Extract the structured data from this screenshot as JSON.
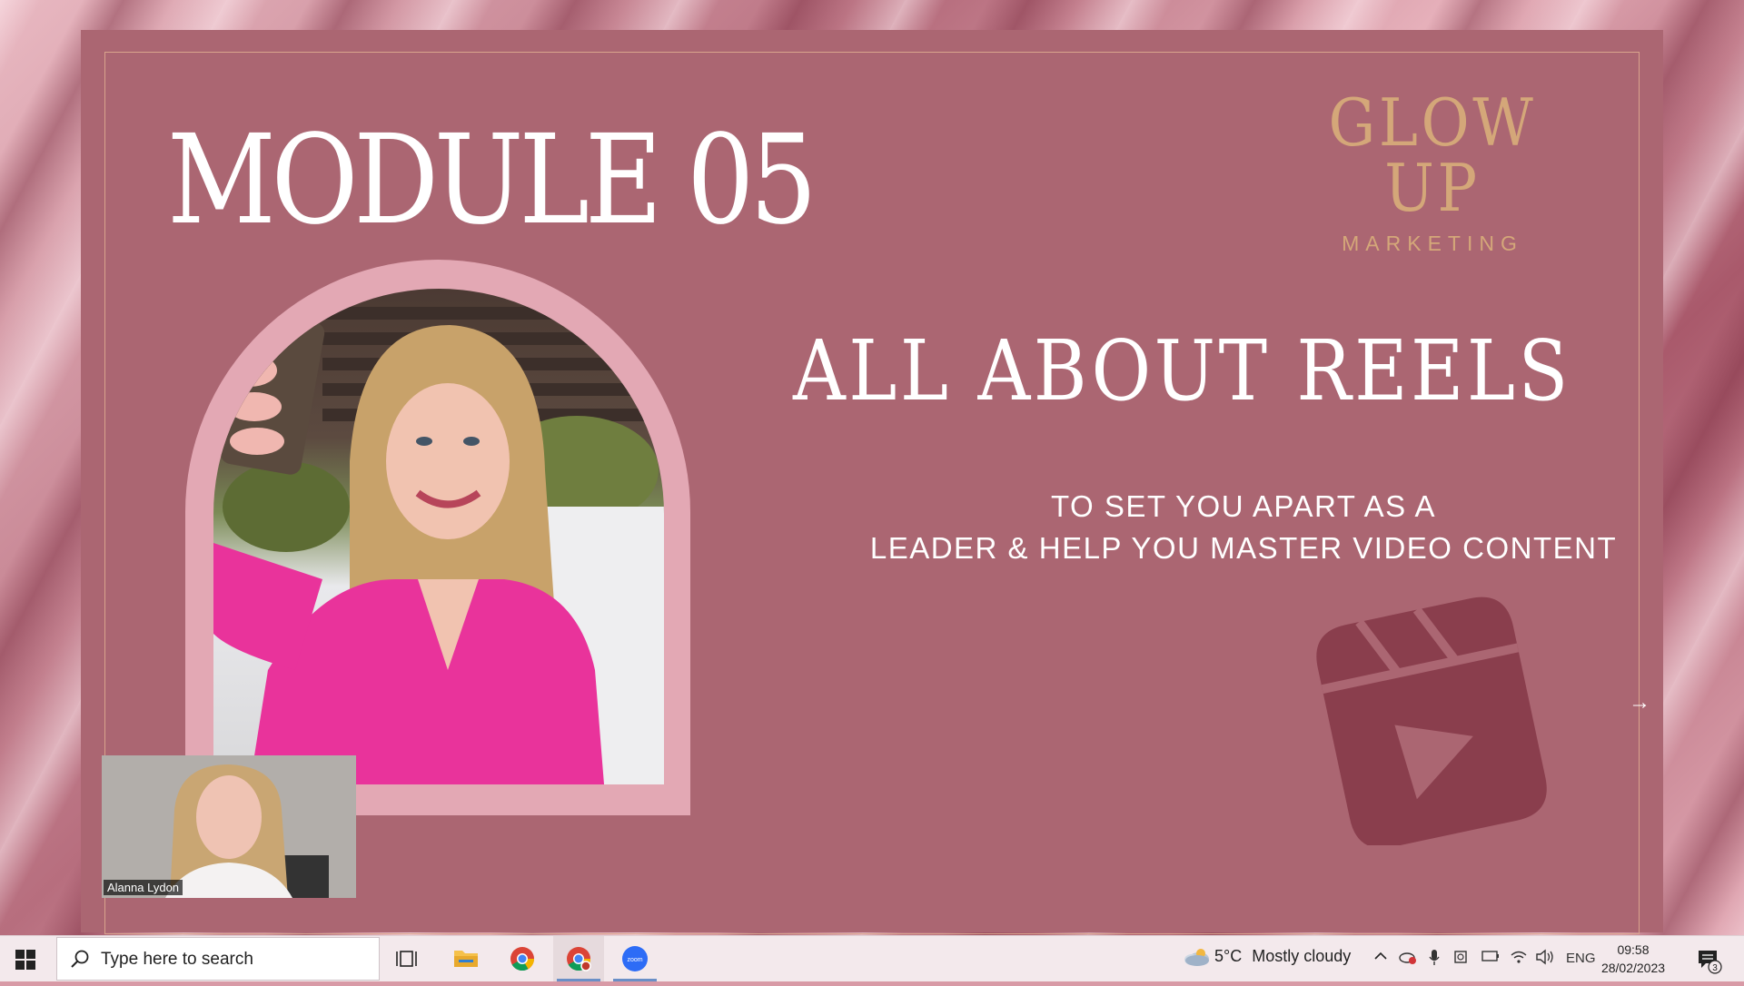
{
  "slide": {
    "module_title": "MODULE 05",
    "brand_main": "GLOW UP",
    "brand_sub": "MARKETING",
    "headline": "ALL ABOUT REELS",
    "subline_1": "TO SET YOU APART AS A",
    "subline_2": "LEADER & HELP YOU MASTER VIDEO CONTENT",
    "icon": "reels-clapper-play-icon"
  },
  "webcam": {
    "participant_name": "Alanna Lydon"
  },
  "taskbar": {
    "search_placeholder": "Type here to search",
    "apps": [
      "task-view",
      "file-explorer",
      "chrome",
      "chrome-profile",
      "zoom"
    ],
    "weather_temp": "5°C",
    "weather_desc": "Mostly cloudy",
    "language": "ENG",
    "time": "09:58",
    "date": "28/02/2023",
    "notification_count": "3"
  },
  "colors": {
    "slide_bg": "#ab6672",
    "gold": "#d4a779",
    "arch": "#e3a8b4",
    "reels_icon": "#8a3e4d"
  }
}
